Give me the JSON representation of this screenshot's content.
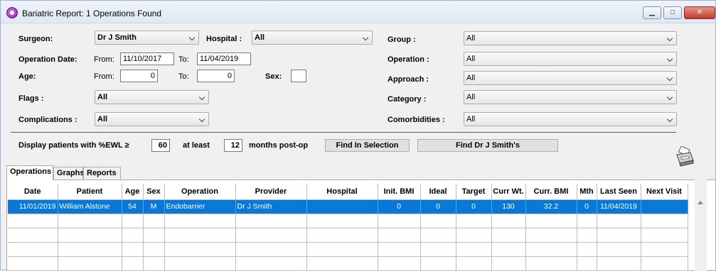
{
  "window": {
    "title": "Bariatric Report: 1 Operations Found",
    "controls": {
      "minimize": "▁",
      "maximize": "□",
      "close": "✕"
    }
  },
  "filters": {
    "surgeon": {
      "label": "Surgeon:",
      "value": "Dr J Smith"
    },
    "hospital": {
      "label": "Hospital :",
      "value": "All"
    },
    "operation_date": {
      "label": "Operation Date:",
      "from_label": "From:",
      "from": "11/10/2017",
      "to_label": "To:",
      "to": "11/04/2019"
    },
    "age": {
      "label": "Age:",
      "from_label": "From:",
      "from": "0",
      "to_label": "To:",
      "to": "0"
    },
    "sex": {
      "label": "Sex:",
      "value": ""
    },
    "flags": {
      "label": "Flags :",
      "value": "All"
    },
    "complications": {
      "label": "Complications :",
      "value": "All"
    },
    "group": {
      "label": "Group :",
      "value": "All"
    },
    "operation": {
      "label": "Operation :",
      "value": "All"
    },
    "approach": {
      "label": "Approach :",
      "value": "All"
    },
    "category": {
      "label": "Category :",
      "value": "All"
    },
    "comorbidities": {
      "label": "Comorbidities :",
      "value": "All"
    }
  },
  "display": {
    "ewl_label": "Display patients with %EWL ≥",
    "ewl_value": "60",
    "at_least_label": "at least",
    "months_value": "12",
    "months_label": "months post-op",
    "find_in_selection": "Find In Selection",
    "find_surgeon": "Find Dr J Smith's"
  },
  "tabs": [
    "Operations",
    "Graphs",
    "Reports"
  ],
  "grid": {
    "columns": [
      "Date",
      "Patient",
      "Age",
      "Sex",
      "Operation",
      "Provider",
      "Hospital",
      "Init. BMI",
      "Ideal",
      "Target",
      "Curr Wt.",
      "Curr. BMI",
      "Mth",
      "Last Seen",
      "Next Visit"
    ],
    "rows": [
      [
        "11/01/2019",
        "William Alstone",
        "54",
        "M",
        "Endobarrier",
        "Dr J Smith",
        "",
        "0",
        "0",
        "0",
        "130",
        "32.2",
        "0",
        "11/04/2019",
        ""
      ]
    ]
  },
  "colors": {
    "selection": "#0a78d7",
    "window_bg": "#f0f0f0"
  }
}
